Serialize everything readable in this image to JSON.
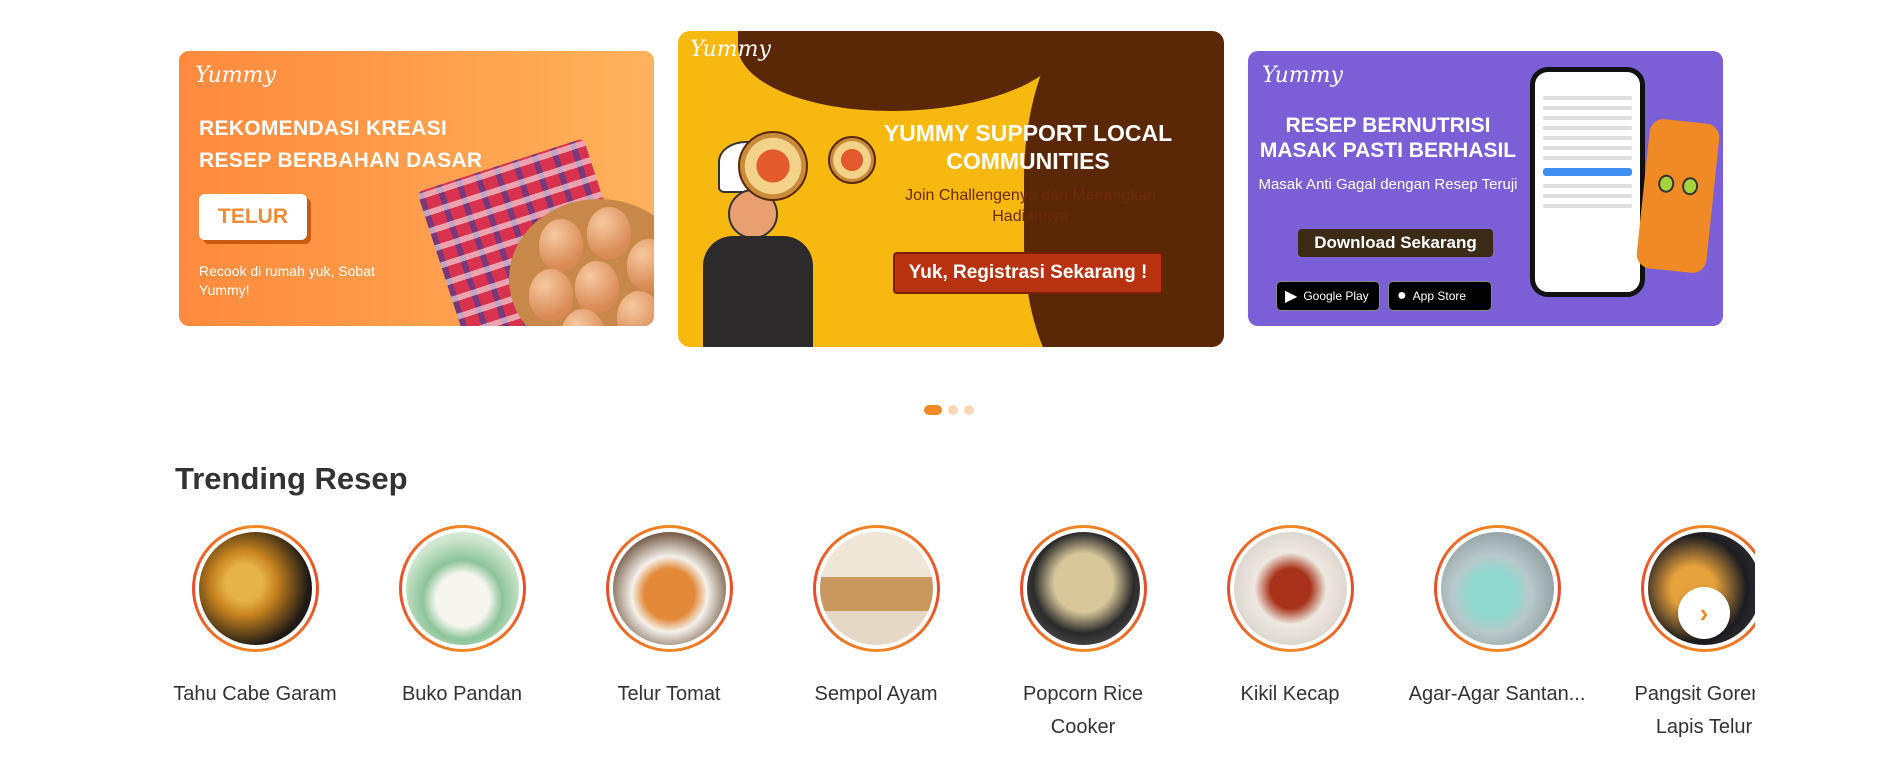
{
  "banners": [
    {
      "brand": "Yummy",
      "headline": "REKOMENDASI KREASI RESEP BERBAHAN DASAR",
      "cta": "TELUR",
      "subtext": "Recook di rumah yuk, Sobat Yummy!"
    },
    {
      "brand": "Yummy",
      "headline": "YUMMY SUPPORT LOCAL COMMUNITIES",
      "subtext": "Join Challengenya dan Menangkan Hadiahnya",
      "cta": "Yuk, Registrasi Sekarang !"
    },
    {
      "brand": "Yummy",
      "headline": "RESEP BERNUTRISI MASAK PASTI BERHASIL",
      "subtext": "Masak Anti Gagal dengan Resep Teruji",
      "cta": "Download Sekarang",
      "google_play": "Google Play",
      "app_store": "App Store"
    }
  ],
  "carousel": {
    "active_index": 0,
    "count": 3
  },
  "trending": {
    "title": "Trending Resep",
    "items": [
      {
        "label": "Tahu Cabe Garam"
      },
      {
        "label": "Buko Pandan"
      },
      {
        "label": "Telur Tomat"
      },
      {
        "label": "Sempol Ayam"
      },
      {
        "label": "Popcorn Rice Cooker"
      },
      {
        "label": "Kikil Kecap"
      },
      {
        "label": "Agar-Agar Santan..."
      },
      {
        "label": "Pangsit Goreng Lapis Telur"
      }
    ],
    "next_icon": "chevron-right-icon"
  },
  "colors": {
    "accent": "#f08a24",
    "ring_red": "#e84b2a"
  }
}
